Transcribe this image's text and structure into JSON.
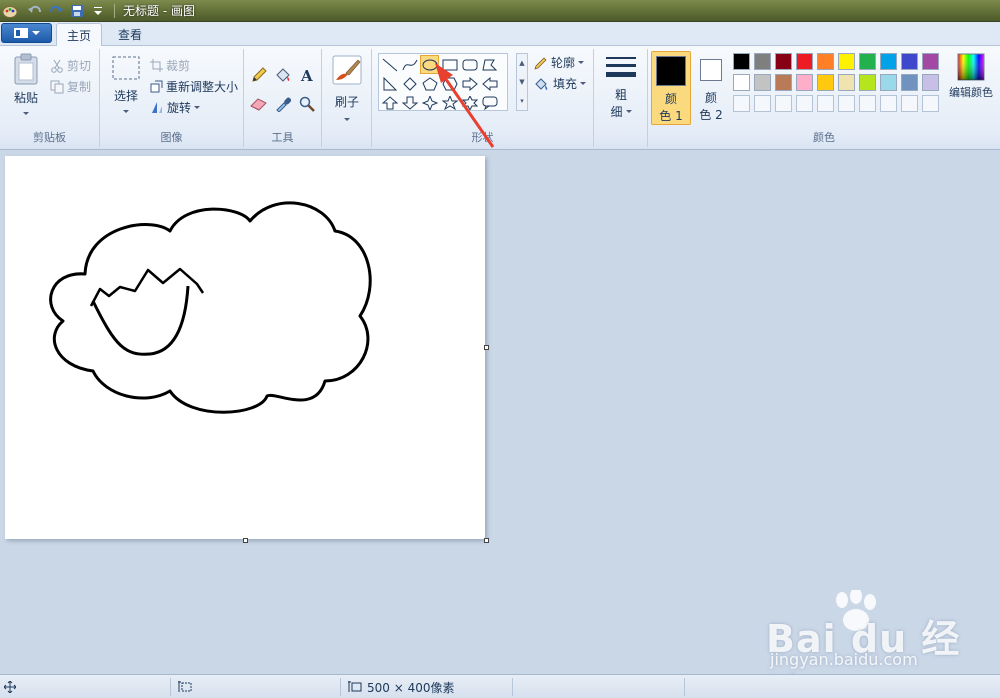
{
  "window": {
    "title": "无标题 - 画图"
  },
  "tabs": [
    {
      "label": "主页"
    },
    {
      "label": "查看"
    }
  ],
  "clipboard": {
    "paste": "粘贴",
    "cut": "剪切",
    "copy": "复制",
    "group": "剪贴板"
  },
  "image": {
    "select": "选择",
    "crop": "裁剪",
    "resize": "重新调整大小",
    "rotate": "旋转",
    "group": "图像"
  },
  "tools": {
    "group": "工具"
  },
  "brush": {
    "label": "刷子"
  },
  "shapes": {
    "group": "形状",
    "outline": "轮廓",
    "fill": "填充",
    "selected": "oval-icon"
  },
  "size": {
    "label1": "粗",
    "label2": "细"
  },
  "colors": {
    "color1_line1": "颜",
    "color1_line2": "色 1",
    "color2_line1": "颜",
    "color2_line2": "色 2",
    "edit": "编辑颜色",
    "group": "颜色",
    "color1_value": "#000000",
    "color2_value": "#ffffff",
    "palette": [
      "#000000",
      "#7f7f7f",
      "#880015",
      "#ed1c24",
      "#ff7f27",
      "#fff200",
      "#22b14c",
      "#00a2e8",
      "#3f48cc",
      "#a349a4",
      "#ffffff",
      "#c3c3c3",
      "#b97a57",
      "#ffaec9",
      "#ffc90e",
      "#efe4b0",
      "#b5e61d",
      "#99d9ea",
      "#7092be",
      "#c8bfe7"
    ]
  },
  "status": {
    "dimensions": "500 × 400像素"
  },
  "watermark": {
    "brand": "Bai du 经验",
    "url": "jingyan.baidu.com"
  }
}
